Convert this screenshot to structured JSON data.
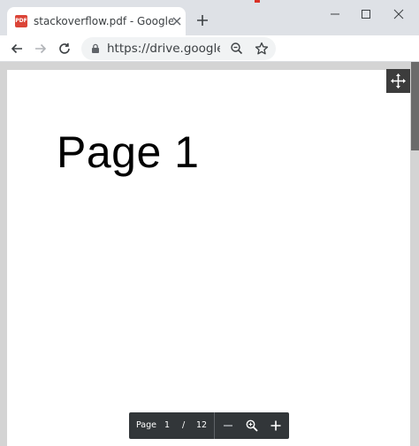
{
  "tab": {
    "favicon_text": "PDF",
    "title": "stackoverflow.pdf - Google Drive",
    "close_icon": "close-icon"
  },
  "window_controls": [
    "minimize-icon",
    "maximize-icon",
    "close-icon"
  ],
  "toolbar": {
    "url": "https://drive.google.co...",
    "icons": [
      "back-arrow-icon",
      "forward-arrow-icon",
      "reload-icon",
      "lock-icon",
      "zoom-icon",
      "star-icon"
    ]
  },
  "document": {
    "heading": "Page 1"
  },
  "pdf_toolbar": {
    "page_label": "Page",
    "current_page": "1",
    "separator": "/",
    "total_pages": "12"
  },
  "colors": {
    "tabstrip": "#dee1e6",
    "pdf_toolbar": "#323639",
    "favicon": "#db4437"
  }
}
